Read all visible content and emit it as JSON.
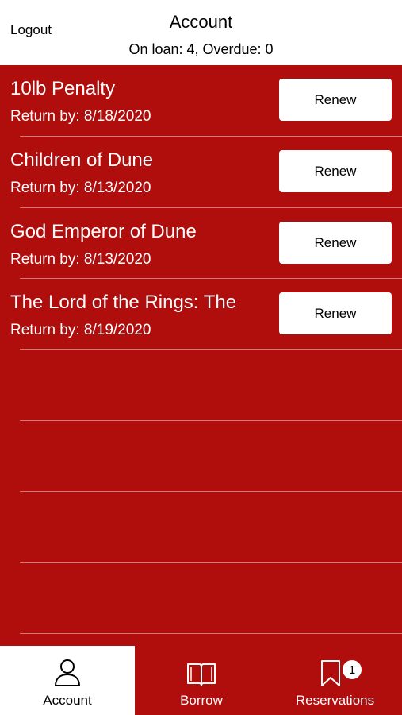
{
  "header": {
    "logout_label": "Logout",
    "title": "Account",
    "subtitle": "On loan: 4, Overdue: 0"
  },
  "loans": [
    {
      "title": "10lb Penalty",
      "return_by": "Return by: 8/18/2020",
      "action": "Renew"
    },
    {
      "title": "Children of Dune",
      "return_by": "Return by: 8/13/2020",
      "action": "Renew"
    },
    {
      "title": "God Emperor of Dune",
      "return_by": "Return by: 8/13/2020",
      "action": "Renew"
    },
    {
      "title": "The Lord of the Rings: The",
      "return_by": "Return by: 8/19/2020",
      "action": "Renew"
    }
  ],
  "tabs": [
    {
      "label": "Account",
      "icon": "person-icon",
      "active": true
    },
    {
      "label": "Borrow",
      "icon": "book-icon",
      "active": false
    },
    {
      "label": "Reservations",
      "icon": "bookmark-icon",
      "active": false,
      "badge": "1"
    }
  ],
  "colors": {
    "brand_red": "#b00d0d",
    "header_bg": "#ffffff",
    "text_on_red": "#ffffff"
  }
}
